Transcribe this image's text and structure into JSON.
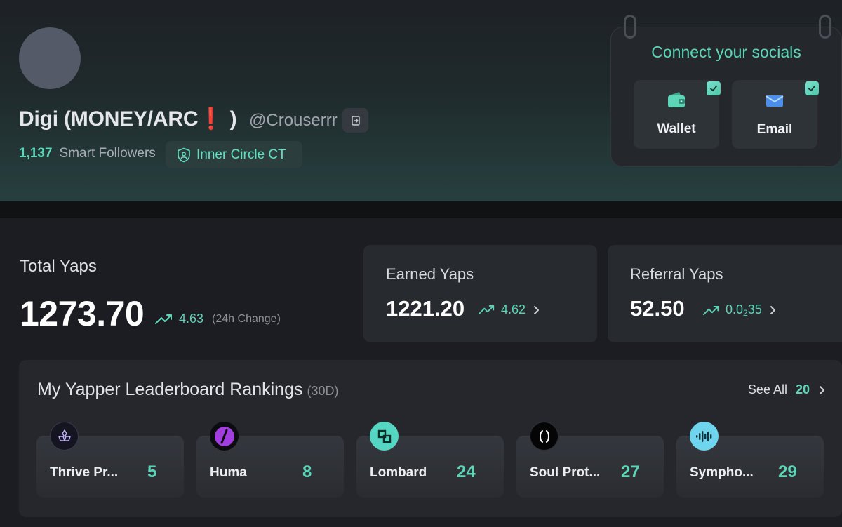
{
  "profile": {
    "display_name": "Digi (MONEY/ARC",
    "display_name_emoji": "❗",
    "display_name_close": " )",
    "handle": "@Crouserrr",
    "followers_count": "1,137",
    "followers_label": "Smart Followers",
    "badge_label": "Inner Circle CT",
    "icons": {
      "signout": "sign-out-icon",
      "badge": "shield-user-icon"
    }
  },
  "socials": {
    "title": "Connect your socials",
    "items": [
      {
        "label": "Wallet",
        "icon": "wallet-icon",
        "connected": true
      },
      {
        "label": "Email",
        "icon": "email-icon",
        "connected": true
      }
    ]
  },
  "total_yaps": {
    "label": "Total Yaps",
    "value": "1273.70",
    "change": "4.63",
    "change_note": "(24h Change)"
  },
  "earned_yaps": {
    "label": "Earned Yaps",
    "value": "1221.20",
    "change": "4.62"
  },
  "referral_yaps": {
    "label": "Referral Yaps",
    "value": "52.50",
    "change_prefix": "0.0",
    "change_sub": "2",
    "change_suffix": "35"
  },
  "leaderboard": {
    "title": "My Yapper Leaderboard Rankings",
    "period": "(30D)",
    "see_all_label": "See All",
    "see_all_count": "20",
    "items": [
      {
        "name": "Thrive Pr...",
        "rank": "5",
        "logo": "thrive-logo-icon"
      },
      {
        "name": "Huma",
        "rank": "8",
        "logo": "huma-logo-icon"
      },
      {
        "name": "Lombard",
        "rank": "24",
        "logo": "lombard-logo-icon"
      },
      {
        "name": "Soul Prot...",
        "rank": "27",
        "logo": "soul-protocol-logo-icon"
      },
      {
        "name": "Sympho...",
        "rank": "29",
        "logo": "symphony-logo-icon"
      }
    ]
  },
  "colors": {
    "accent": "#5dd6b8",
    "background": "#1c1d22",
    "card": "#272a2f",
    "emoji_red": "#e0262b"
  }
}
